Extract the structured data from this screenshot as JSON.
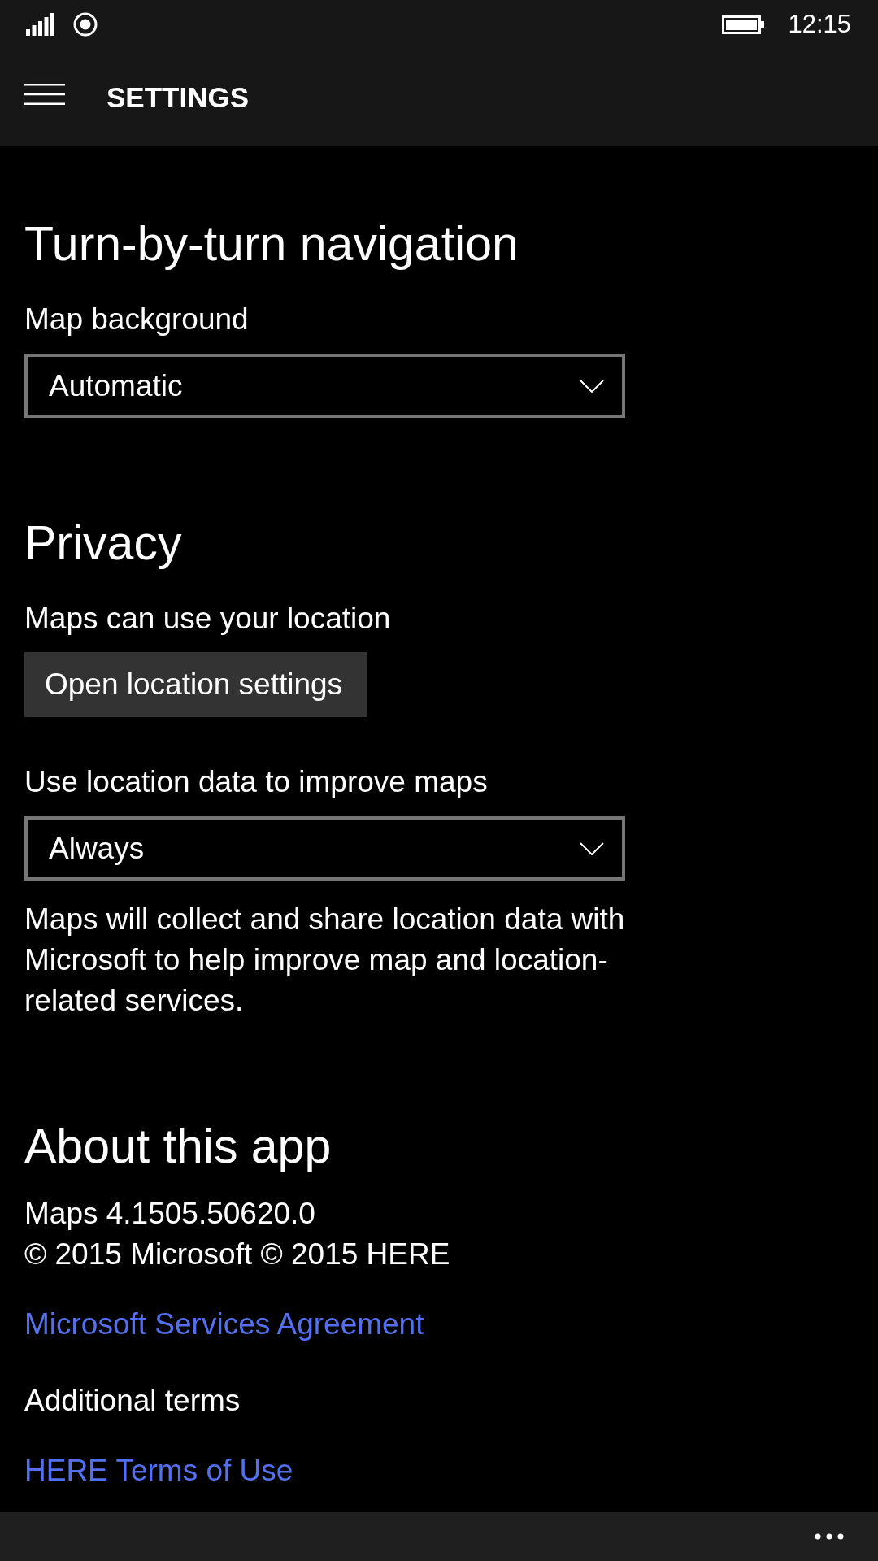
{
  "status_bar": {
    "time": "12:15"
  },
  "header": {
    "title": "SETTINGS"
  },
  "sections": [
    {
      "title": "Turn-by-turn navigation",
      "items": [
        {
          "kind": "label",
          "text": "Map background"
        },
        {
          "kind": "dropdown",
          "value": "Automatic"
        }
      ]
    },
    {
      "title": "Privacy",
      "items": [
        {
          "kind": "label",
          "text": "Maps can use your location"
        },
        {
          "kind": "button",
          "text": "Open location settings"
        },
        {
          "kind": "label",
          "text": "Use location data to improve maps"
        },
        {
          "kind": "dropdown",
          "value": "Always"
        },
        {
          "kind": "note",
          "text": "Maps will collect and share location data with Microsoft to help improve map and location-related services."
        }
      ]
    },
    {
      "title": "About this app",
      "items": [
        {
          "kind": "text",
          "text": "Maps 4.1505.50620.0"
        },
        {
          "kind": "text",
          "text": "© 2015 Microsoft © 2015 HERE"
        },
        {
          "kind": "link",
          "text": "Microsoft Services Agreement"
        },
        {
          "kind": "text",
          "text": "Additional terms"
        },
        {
          "kind": "link",
          "text": "HERE Terms of Use"
        }
      ]
    }
  ]
}
